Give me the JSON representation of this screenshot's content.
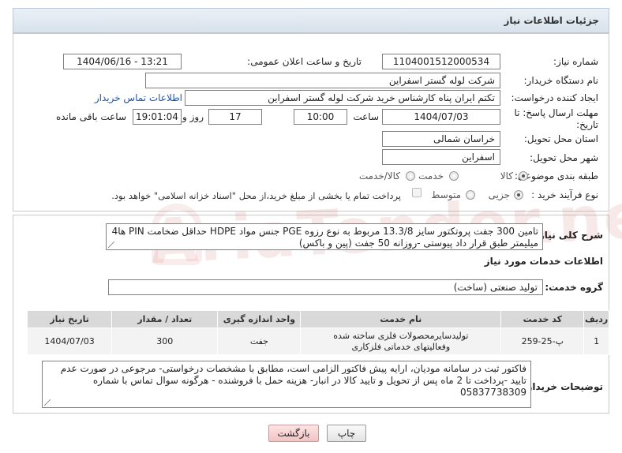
{
  "header": {
    "title": "جزئیات اطلاعات نیاز"
  },
  "fields": {
    "need_number_label": "شماره نیاز:",
    "need_number": "1104001512000534",
    "announce_label": "تاریخ و ساعت اعلان عمومی:",
    "announce_value": "1404/06/16 - 13:21",
    "buyer_org_label": "نام دستگاه خریدار:",
    "buyer_org": "شرکت لوله گستر اسفراین",
    "creator_label": "ایجاد کننده درخواست:",
    "creator": "تکتم ایران پناه کارشناس خرید شرکت لوله گستر اسفراین",
    "contact_link": "اطلاعات تماس خریدار",
    "deadline_label_1": "مهلت ارسال پاسخ: تا",
    "deadline_label_2": "تاریخ:",
    "deadline_date": "1404/07/03",
    "time_label": "ساعت",
    "deadline_time": "10:00",
    "days_value": "17",
    "days_label": "روز و",
    "remaining_time": "19:01:04",
    "remaining_label": "ساعت باقی مانده",
    "province_label": "استان محل تحویل:",
    "province": "خراسان شمالی",
    "city_label": "شهر محل تحویل:",
    "city": "اسفراین",
    "category_label": "طبقه بندی موضوعی:",
    "category_options": [
      "کالا",
      "خدمت",
      "کالا/خدمت"
    ],
    "category_selected": "کالا",
    "process_label": "نوع فرآیند خرید :",
    "process_options": [
      "جزیی",
      "متوسط"
    ],
    "process_selected": "جزیی",
    "payment_note": "پرداخت تمام یا بخشی از مبلغ خرید،از محل \"اسناد خزانه اسلامی\" خواهد بود."
  },
  "summary": {
    "label": "شرح کلی نیاز:",
    "text": "تامین 300 جفت پروتکتور سایز 13.3/8 مربوط به نوع رزوه PGE جنس مواد HDPE حداقل ضخامت PIN ها4 میلیمتر طبق  قرار داد پیوستی -روزانه 50 جفت (پین و باکس)"
  },
  "services": {
    "section_title": "اطلاعات خدمات مورد نیاز",
    "group_label": "گروه خدمت:",
    "group_value": "تولید صنعتی (ساخت)",
    "columns": [
      "ردیف",
      "کد خدمت",
      "نام خدمت",
      "واحد اندازه گیری",
      "تعداد / مقدار",
      "تاریخ نیاز"
    ],
    "rows": [
      [
        "1",
        "پ-25-259",
        "تولیدسایرمحصولات فلزی ساخته شده وفعالیتهای خدماتی فلزکاری",
        "جفت",
        "300",
        "1404/07/03"
      ]
    ]
  },
  "buyer_notes": {
    "label": "توضیحات خریدار:",
    "text": "فاکتور ثبت در سامانه مودیان، ارایه پیش فاکتور الزامی است، مطابق با مشخصات درخواستی- مرجوعی در صورت عدم تایید -پرداخت تا 2 ماه پس از تحویل و تایید کالا در انبار- هزینه حمل با فروشنده - هرگونه سوال تماس با شماره 05837738309"
  },
  "buttons": {
    "print": "چاپ",
    "back": "بازگشت"
  },
  "watermark": "AriaTender.net",
  "colors": {
    "link": "#1a55b0",
    "header_bg": "#dfe7ef",
    "back_button": "#f3c3c3"
  }
}
